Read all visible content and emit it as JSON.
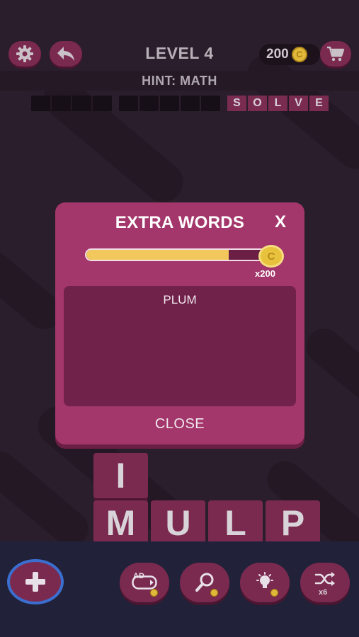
{
  "header": {
    "level_title": "LEVEL 4",
    "coins": "200",
    "coin_symbol": "C",
    "hint": "HINT: MATH"
  },
  "answer": {
    "solve_letters": [
      "S",
      "O",
      "L",
      "V",
      "E"
    ]
  },
  "letter_tiles": [
    "I",
    "M",
    "U",
    "L",
    "P"
  ],
  "modal": {
    "title": "EXTRA WORDS",
    "close_x": "X",
    "progress": 0.78,
    "coin_symbol": "C",
    "reward": "x200",
    "words": [
      "PLUM"
    ],
    "close_button": "CLOSE"
  },
  "toolbar": {
    "ad_label": "AD",
    "shuffle_count": "x6"
  },
  "colors": {
    "background": "#2b1e2c",
    "tile": "#7b2a4f",
    "modal": "#a3366a",
    "panel": "#70224a",
    "coin": "#e8c23c",
    "accent_ring": "#3a6fd0"
  },
  "icons": [
    "gear-icon",
    "back-arrow-icon",
    "coin-icon",
    "cart-icon",
    "plus-icon",
    "ad-video-icon",
    "magnifier-icon",
    "lightbulb-icon",
    "shuffle-icon"
  ]
}
